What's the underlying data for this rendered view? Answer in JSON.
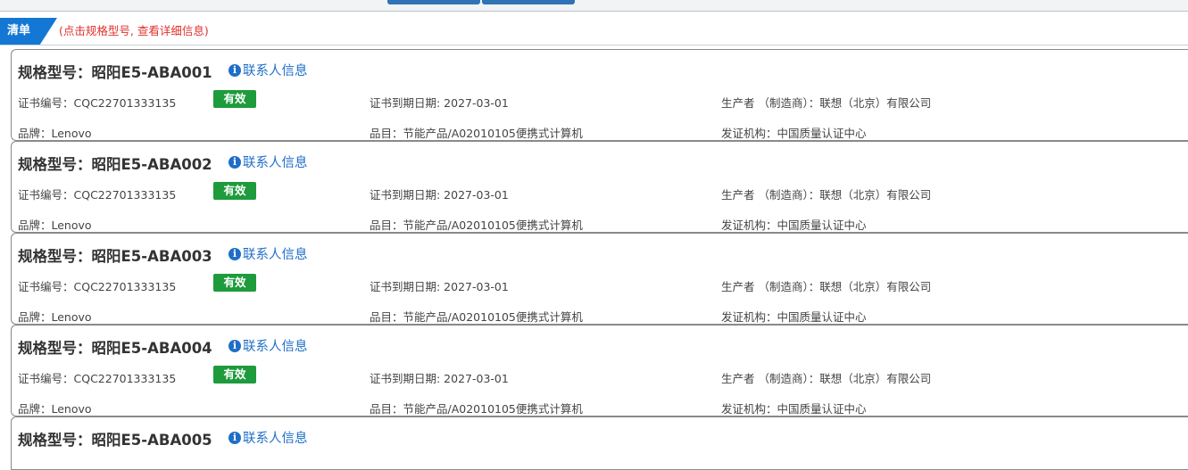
{
  "tab": {
    "label": "清单",
    "hint": "(点击规格型号, 查看详细信息)"
  },
  "contact_icon": "info-circle-icon",
  "colors": {
    "tab": "#1477d4",
    "hint": "#e0312b",
    "link": "#1e6ec8",
    "badge": "#1e9b3c"
  },
  "items": [
    {
      "title": "规格型号：昭阳E5-ABA001",
      "contact_label": "联系人信息",
      "cert_no": "证书编号：CQC22701333135",
      "status": "有效",
      "expiry": "证书到期日期: 2027-03-01",
      "maker": "生产者 （制造商）：联想（北京）有限公司",
      "brand": "品牌：Lenovo",
      "category": "品目：节能产品/A02010105便携式计算机",
      "issuer": "发证机构：中国质量认证中心"
    },
    {
      "title": "规格型号：昭阳E5-ABA002",
      "contact_label": "联系人信息",
      "cert_no": "证书编号：CQC22701333135",
      "status": "有效",
      "expiry": "证书到期日期: 2027-03-01",
      "maker": "生产者 （制造商）：联想（北京）有限公司",
      "brand": "品牌：Lenovo",
      "category": "品目：节能产品/A02010105便携式计算机",
      "issuer": "发证机构：中国质量认证中心"
    },
    {
      "title": "规格型号：昭阳E5-ABA003",
      "contact_label": "联系人信息",
      "cert_no": "证书编号：CQC22701333135",
      "status": "有效",
      "expiry": "证书到期日期: 2027-03-01",
      "maker": "生产者 （制造商）：联想（北京）有限公司",
      "brand": "品牌：Lenovo",
      "category": "品目：节能产品/A02010105便携式计算机",
      "issuer": "发证机构：中国质量认证中心"
    },
    {
      "title": "规格型号：昭阳E5-ABA004",
      "contact_label": "联系人信息",
      "cert_no": "证书编号：CQC22701333135",
      "status": "有效",
      "expiry": "证书到期日期: 2027-03-01",
      "maker": "生产者 （制造商）：联想（北京）有限公司",
      "brand": "品牌：Lenovo",
      "category": "品目：节能产品/A02010105便携式计算机",
      "issuer": "发证机构：中国质量认证中心"
    },
    {
      "title": "规格型号：昭阳E5-ABA005",
      "contact_label": "联系人信息"
    }
  ]
}
